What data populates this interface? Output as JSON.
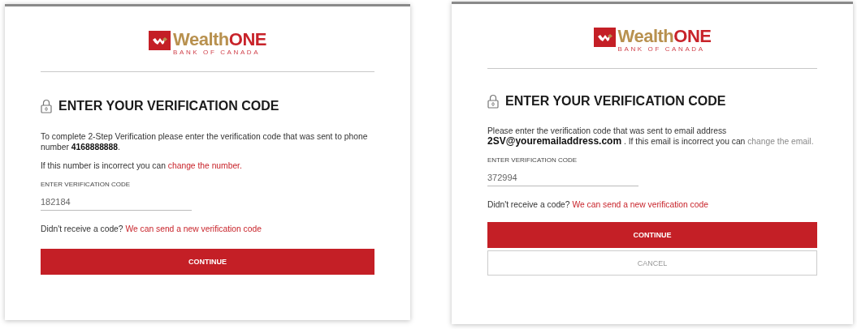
{
  "panels": [
    {
      "logo": {
        "brand_a": "Wealth",
        "brand_b": "ONE",
        "tagline": "BANK OF CANADA"
      },
      "title": "ENTER YOUR VERIFICATION CODE",
      "messages": [
        {
          "text": "To complete 2-Step Verification please enter the verification code that was sent to phone number **4168888888**."
        },
        {
          "text": "If this number is incorrect you can ",
          "link": {
            "label": "change the number.",
            "kind": "accent"
          }
        }
      ],
      "field": {
        "label": "ENTER VERIFICATION CODE",
        "value": "182184"
      },
      "resend": {
        "text": "Didn't receive a code?",
        "link": "We can send a new verification code"
      },
      "buttons": [
        {
          "label": "CONTINUE",
          "kind": "primary"
        }
      ]
    },
    {
      "logo": {
        "brand_a": "Wealth",
        "brand_b": "ONE",
        "tagline": "BANK OF CANADA"
      },
      "title": "ENTER YOUR VERIFICATION CODE",
      "messages": [
        {
          "text": "Please enter the verification code that was sent to email address **2SV@youremailaddress.com** . If this email is incorrect you can ",
          "link": {
            "label": "change the email.",
            "kind": "muted"
          }
        }
      ],
      "field": {
        "label": "ENTER VERIFICATION CODE",
        "value": "372994"
      },
      "resend": {
        "text": "Didn't receive a code?",
        "link": "We can send a new verification code"
      },
      "buttons": [
        {
          "label": "CONTINUE",
          "kind": "primary"
        },
        {
          "label": "CANCEL",
          "kind": "secondary"
        }
      ]
    }
  ]
}
